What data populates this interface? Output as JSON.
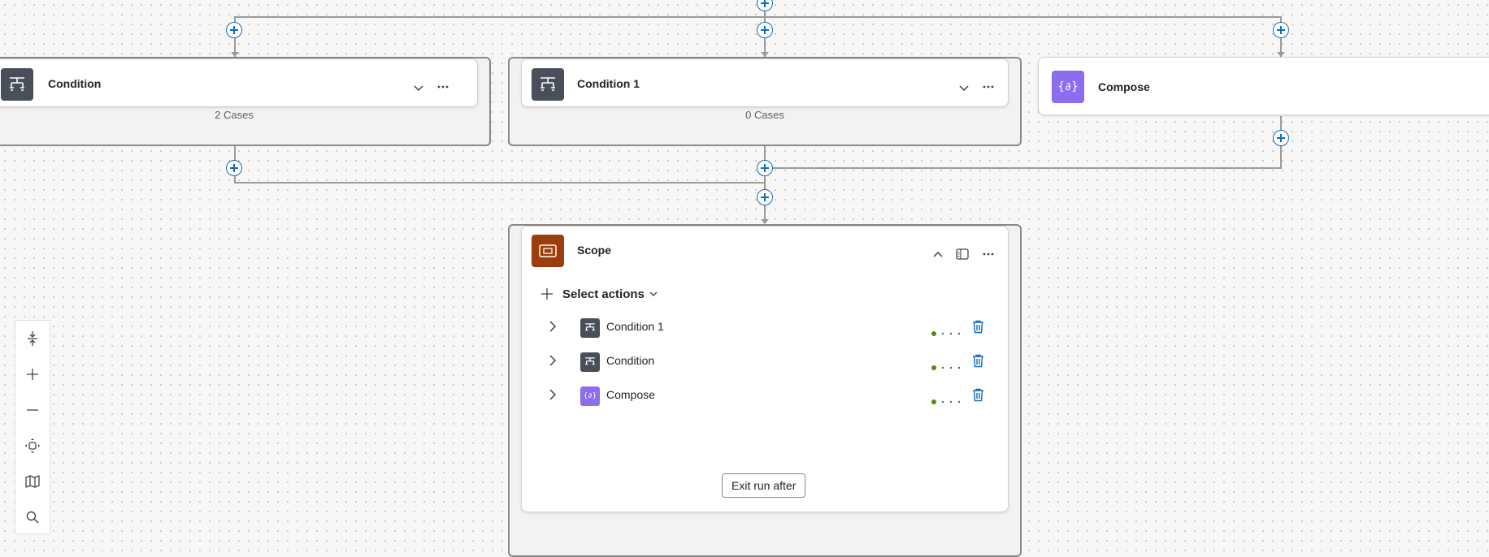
{
  "nodes": {
    "condition": {
      "title": "Condition",
      "cases": "2 Cases"
    },
    "condition1": {
      "title": "Condition 1",
      "cases": "0 Cases"
    },
    "compose": {
      "title": "Compose"
    },
    "scope": {
      "title": "Scope",
      "select_actions_label": "Select actions",
      "actions": [
        {
          "label": "Condition 1",
          "icon": "condition-icon"
        },
        {
          "label": "Condition",
          "icon": "condition-icon"
        },
        {
          "label": "Compose",
          "icon": "compose-icon"
        }
      ],
      "exit_label": "Exit run after"
    }
  },
  "toolbar": [
    "fit-height-icon",
    "zoom-in-icon",
    "zoom-out-icon",
    "fit-view-icon",
    "minimap-icon",
    "search-icon"
  ],
  "colors": {
    "accent": "#0f6cbd",
    "condition_icon_bg": "#484f58",
    "compose_icon_bg": "#8c6cef",
    "scope_icon_bg": "#9c3d0d",
    "status_success": "#4f8a10",
    "delete": "#0f6cbd"
  }
}
